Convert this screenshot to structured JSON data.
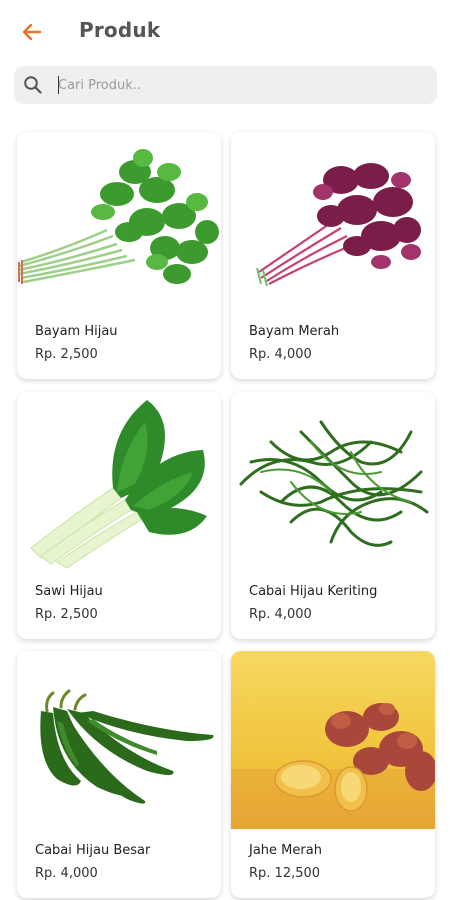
{
  "header": {
    "title": "Produk",
    "back_icon": "arrow-left-icon",
    "accent": "#e8732c"
  },
  "search": {
    "placeholder": "Cari Produk..",
    "icon": "search-icon"
  },
  "products": [
    {
      "name": "Bayam Hijau",
      "price": "Rp. 2,500"
    },
    {
      "name": "Bayam Merah",
      "price": "Rp. 4,000"
    },
    {
      "name": "Sawi Hijau",
      "price": "Rp. 2,500"
    },
    {
      "name": "Cabai Hijau Keriting",
      "price": "Rp. 4,000"
    },
    {
      "name": "Cabai Hijau Besar",
      "price": "Rp. 4,000"
    },
    {
      "name": "Jahe Merah",
      "price": "Rp. 12,500"
    }
  ]
}
